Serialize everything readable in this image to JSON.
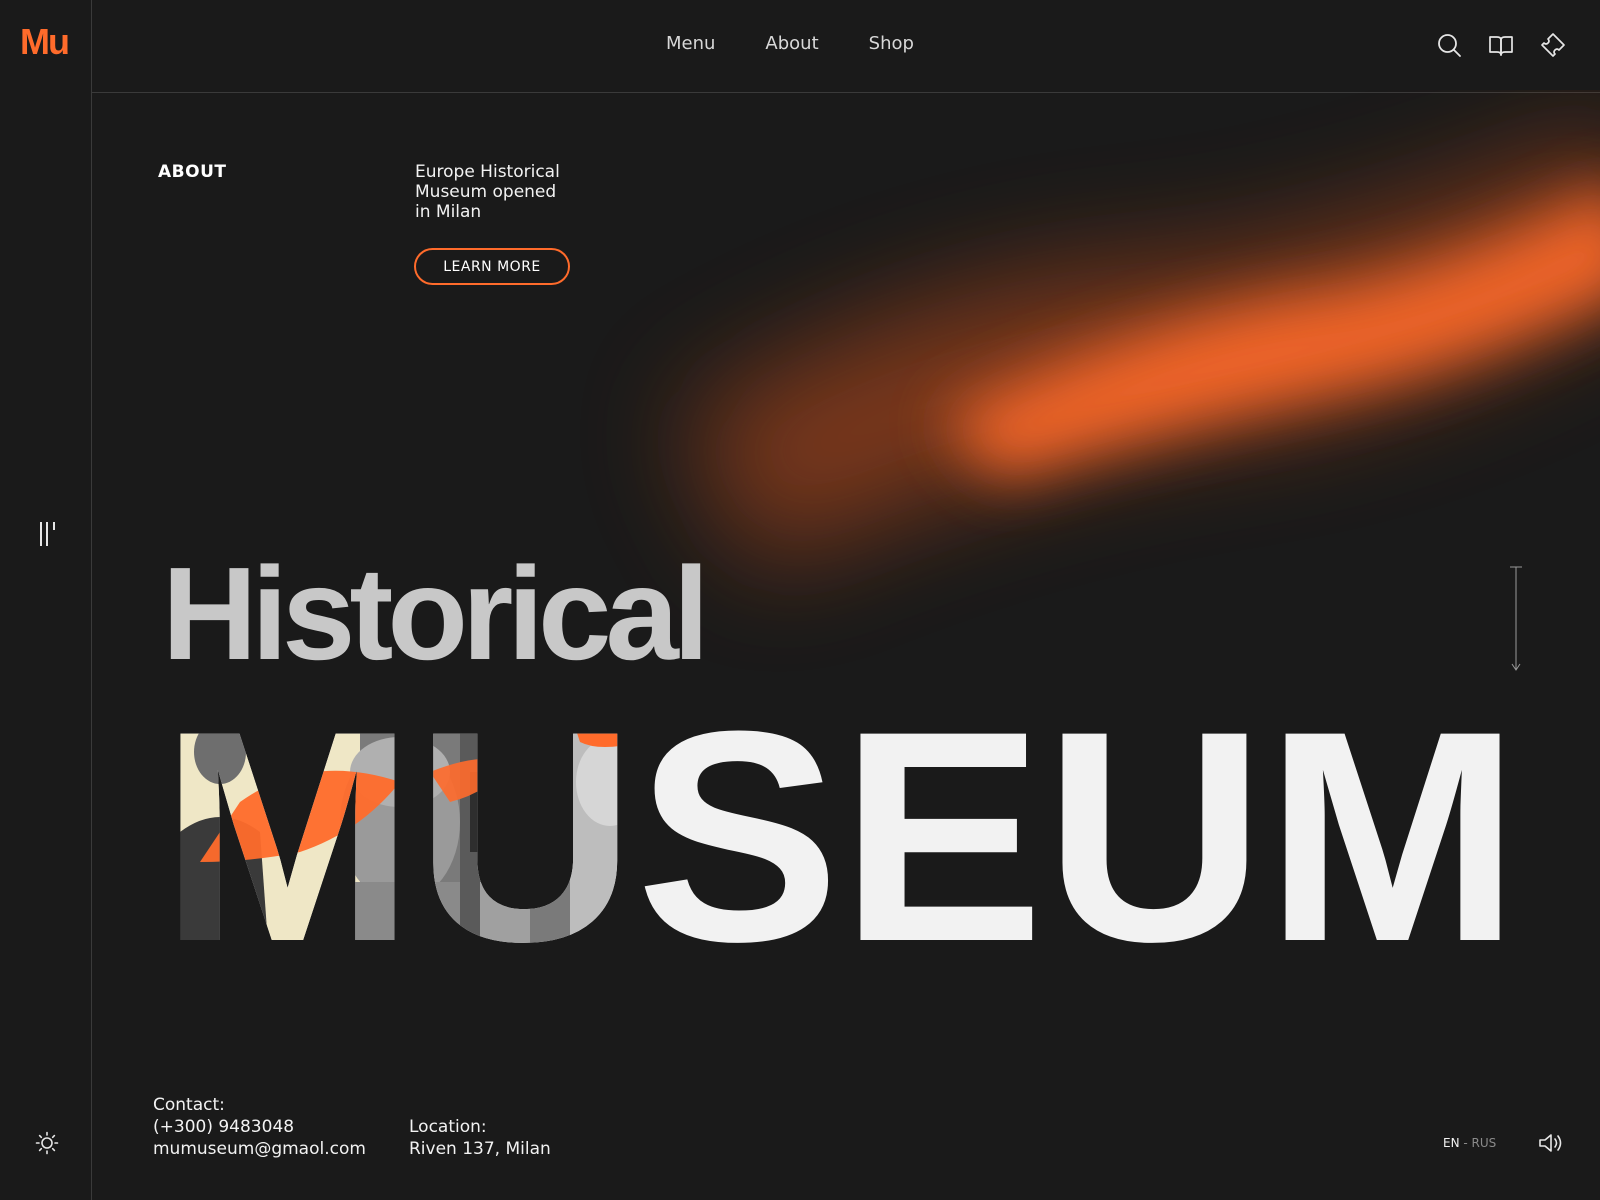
{
  "brand": {
    "logo": "Mu",
    "accent": "#ff6b2b"
  },
  "nav": {
    "items": [
      {
        "label": "Menu"
      },
      {
        "label": "About"
      },
      {
        "label": "Shop"
      }
    ]
  },
  "top_icons": [
    "search-icon",
    "book-icon",
    "ticket-icon"
  ],
  "about": {
    "label": "ABOUT",
    "line1": "Europe Historical",
    "line2": "Museum opened",
    "line3": "in Milan",
    "button": "LEARN MORE"
  },
  "hero": {
    "line1": "Historical",
    "line2": "MUSEUM"
  },
  "footer": {
    "contact_label": "Contact:",
    "phone": "(+300) 9483048",
    "email": "mumuseum@gmaol.com",
    "location_label": "Location:",
    "address": "Riven 137, Milan",
    "lang_current": "EN",
    "lang_sep": " - ",
    "lang_alt": "RUS"
  },
  "colors": {
    "background": "#1a1a1a",
    "text": "#f2f2f2",
    "headline_gray": "#c8c8c8"
  }
}
